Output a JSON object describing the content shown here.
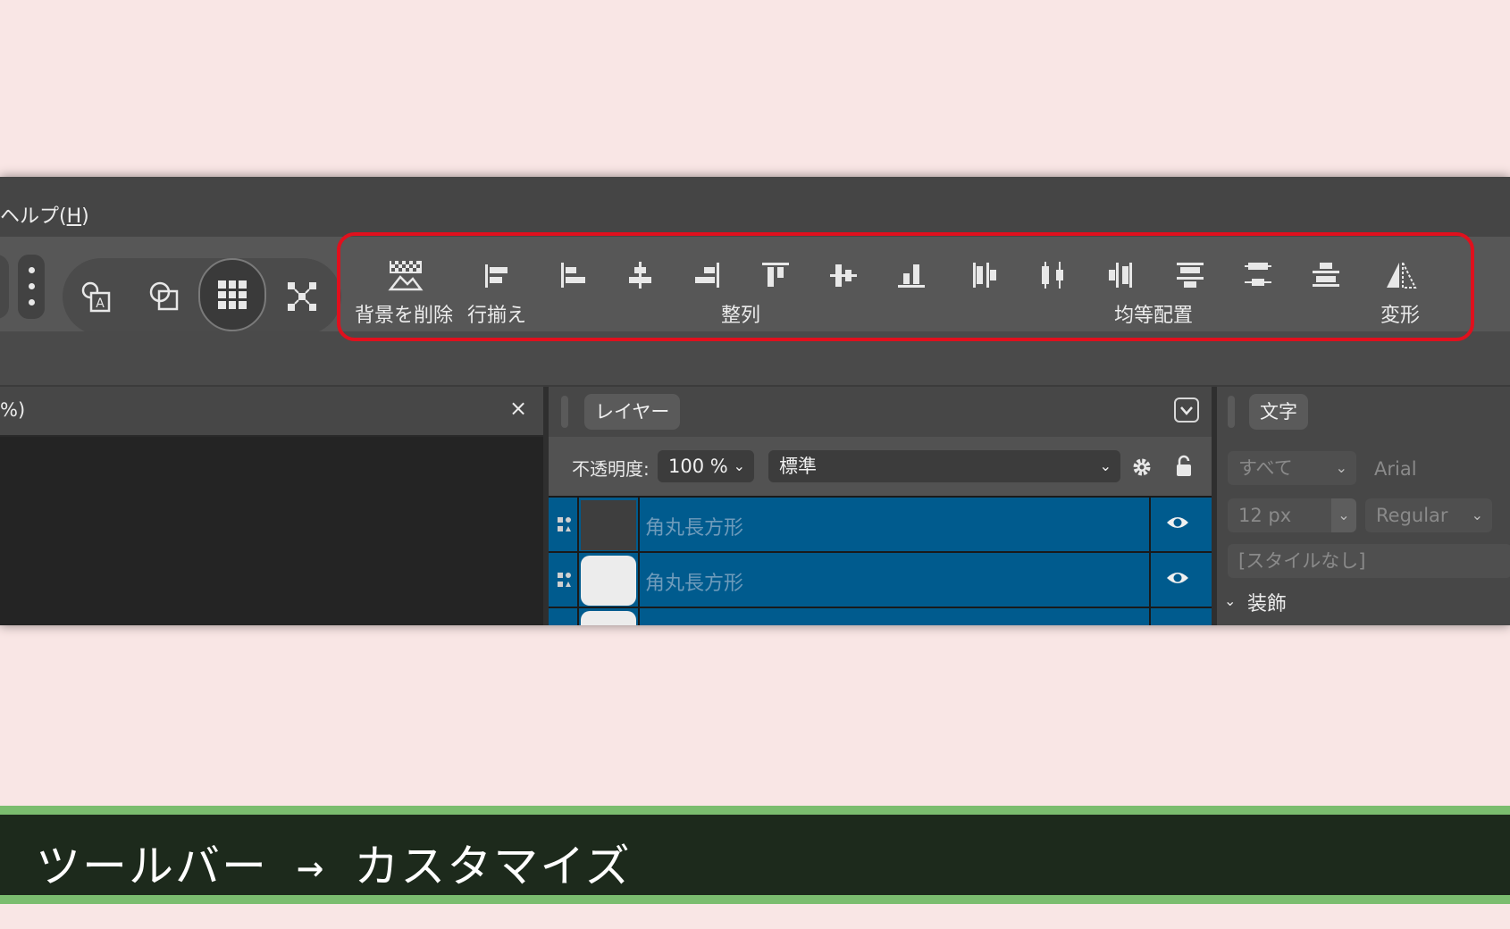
{
  "menu": {
    "help": "ヘルプ(",
    "help_key": "H",
    "help_close": ")"
  },
  "toolbar": {
    "remove_bg": "背景を削除",
    "line_align": "行揃え",
    "align": "整列",
    "distribute": "均等配置",
    "transform": "変形"
  },
  "doc_tab": {
    "title": "%)",
    "close": "×"
  },
  "layers": {
    "tab": "レイヤー",
    "opacity_label": "不透明度:",
    "opacity_value": "100 %",
    "blend_mode": "標準",
    "rows": [
      {
        "name": "角丸長方形"
      },
      {
        "name": "角丸長方形"
      }
    ]
  },
  "character": {
    "tab": "文字",
    "scope": "すべて",
    "font": "Arial",
    "size": "12 px",
    "weight": "Regular",
    "style": "[スタイルなし]",
    "section": "装飾"
  },
  "caption": "ツールバー → カスタマイズ",
  "colors": {
    "highlight": "#e0101d",
    "layer_selected": "#005b8e",
    "caption_bar": "#7bbd6f"
  }
}
